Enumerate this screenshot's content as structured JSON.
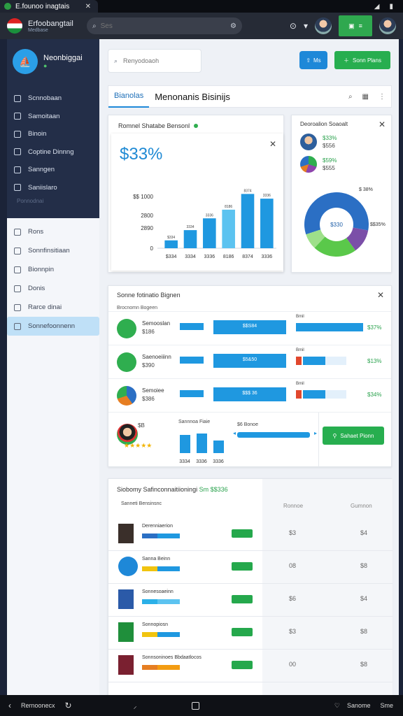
{
  "status": {
    "tab_title": "E.founoo inagtais"
  },
  "header": {
    "brand_title": "Erfoobangtail",
    "brand_sub": "Medbase",
    "search_placeholder": "Ses"
  },
  "sidebar": {
    "profile_name": "Neonbiggai",
    "profile_sub": "●",
    "dark_items": [
      "Scnnobaan",
      "Samoitaan",
      "Binoin",
      "Coptine Dinnng",
      "Sanngen",
      "Saniislaro"
    ],
    "faint_text": "Ponnodnai",
    "light_items": [
      "Rons",
      "Sonnfinsitiaan",
      "Bionnpin",
      "Donis",
      "Rarce dinai",
      "Sonnefoonnenn"
    ]
  },
  "main": {
    "search_placeholder": "Renyodoaoh",
    "blue_btn": "Ms",
    "green_btn": "Sonn Plans",
    "tabs": [
      "Bianolas",
      "Menonanis Bisinijs"
    ]
  },
  "chart_card": {
    "title": "Romnel Shatabe Bensonl",
    "big_value": "$33%",
    "chart_data": {
      "type": "bar",
      "categories": [
        "$334",
        "3334",
        "3336",
        "8186",
        "8374",
        "3336"
      ],
      "values": [
        500,
        1150,
        1900,
        2450,
        3450,
        3150
      ],
      "yticks": [
        "0",
        "2890",
        "2800",
        "$$ 1000"
      ],
      "ylim": [
        0,
        4000
      ]
    }
  },
  "donut_card": {
    "title": "Deoroalion Soaoalt",
    "stats": [
      "$33%",
      "$556",
      "$59%",
      "$555"
    ],
    "chart_data": {
      "type": "pie",
      "labels": [
        "",
        "",
        "",
        ""
      ],
      "values": [
        58,
        22,
        8,
        12
      ],
      "center_label": "$330",
      "slice_labels": [
        "$ 38%",
        "$$35%"
      ]
    }
  },
  "list_card": {
    "title": "Sonne fotinatio Bignen",
    "header_label": "Brocnomn Bogeen",
    "rows": [
      {
        "name": "Semooslan",
        "sub": "$186",
        "bar": "$$S84",
        "head": "Bmil",
        "pct": "$37%"
      },
      {
        "name": "Saenoeiiinn",
        "sub": "$390",
        "bar": "$5&50",
        "head": "Bmil",
        "pct": "$13%"
      },
      {
        "name": "Semoiee",
        "sub": "$386",
        "bar": "$$$ 36",
        "head": "Bmil",
        "pct": "$34%"
      }
    ],
    "last": {
      "tag": "$B",
      "stars": "★★★★★",
      "bars_title": "Sannnoa Fiaie",
      "bars_labels": [
        "3334",
        "3336",
        "3336"
      ],
      "slider_title": "$6 Bonoe",
      "action": "Sahaet Pionn"
    }
  },
  "table_card": {
    "title": "Siobomy Safinconnaitiioningi",
    "title_amount": "Sm $$336",
    "sub_label": "Sanneti Bensinsnc",
    "col_a": "Ronnoe",
    "col_b": "Gumnon",
    "rows": [
      {
        "name": "Derenniaerion",
        "a": "$3",
        "b": "$4"
      },
      {
        "name": "Sanna Beinn",
        "a": "08",
        "b": "$8"
      },
      {
        "name": "Sonnesoaeinn",
        "a": "$6",
        "b": "$4"
      },
      {
        "name": "Sonnopiosn",
        "a": "$3",
        "b": "$8"
      },
      {
        "name": "Sonnsoninoes Bbdaatlocos",
        "a": "00",
        "b": "$8"
      }
    ]
  },
  "navbar": {
    "left": "Rernoonecx",
    "right1": "Sanome",
    "right2": "Sme"
  }
}
